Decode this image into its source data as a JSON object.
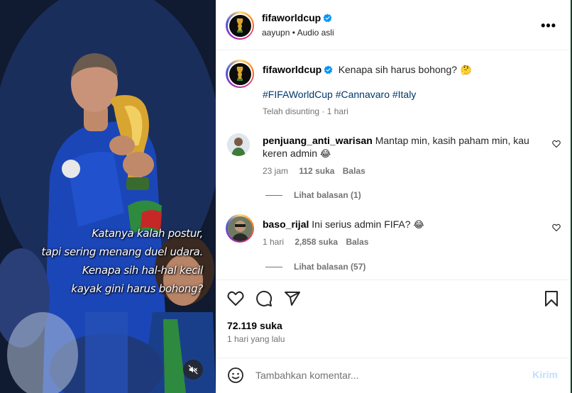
{
  "media": {
    "overlay_lines": [
      "Katanya kalah postur,",
      "tapi sering menang duel udara.",
      "Kenapa sih hal-hal kecil",
      "kayak gini harus bohong?"
    ],
    "mute_icon": "speaker-muted-icon"
  },
  "header": {
    "username": "fifaworldcup",
    "audio_user": "aayupn",
    "audio_sep": " • ",
    "audio_label": "Audio asli",
    "more_label": "•••"
  },
  "caption": {
    "username": "fifaworldcup",
    "text": "Kenapa sih harus bohong?",
    "emoji": "🤔",
    "hashtags": "#FIFAWorldCup #Cannavaro #Italy",
    "edited": "Telah disunting · 1 hari"
  },
  "comments": [
    {
      "username": "penjuang_anti_warisan",
      "text": "Mantap min, kasih paham min, kau keren admin",
      "emoji": "😂",
      "time": "23 jam",
      "likes": "112 suka",
      "reply": "Balas",
      "view_replies": "Lihat balasan (1)"
    },
    {
      "username": "baso_rijal",
      "text": "Ini serius admin FIFA?",
      "emoji": "😂",
      "time": "1 hari",
      "likes": "2,858 suka",
      "reply": "Balas",
      "view_replies": "Lihat balasan (57)"
    }
  ],
  "actions": {
    "likes": "72.119 suka",
    "time_ago": "1 hari yang lalu"
  },
  "add_comment": {
    "placeholder": "Tambahkan komentar...",
    "post_label": "Kirim"
  },
  "colors": {
    "link": "#00376b",
    "secondary": "#737373",
    "post_disabled": "#c0dffd",
    "verified": "#0095f6"
  }
}
